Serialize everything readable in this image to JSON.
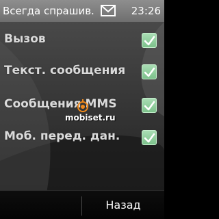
{
  "status_bar": {
    "title": "Всегда спрашив.",
    "time": "23:26",
    "icon": "envelope-icon"
  },
  "options": [
    {
      "label": "Вызов",
      "checked": true
    },
    {
      "label": "Текст. сообщения",
      "checked": true
    },
    {
      "label": "Сообщения MMS",
      "checked": true
    },
    {
      "label": "Моб. перед. дан.",
      "checked": true
    }
  ],
  "softkeys": {
    "right_label": "Назад"
  },
  "watermark": {
    "text": "mobiset.ru"
  },
  "colors": {
    "checkbox_fill": "#8fcf9c",
    "status_bar": "#7d7d7d",
    "softkey_bar": "#080808"
  }
}
